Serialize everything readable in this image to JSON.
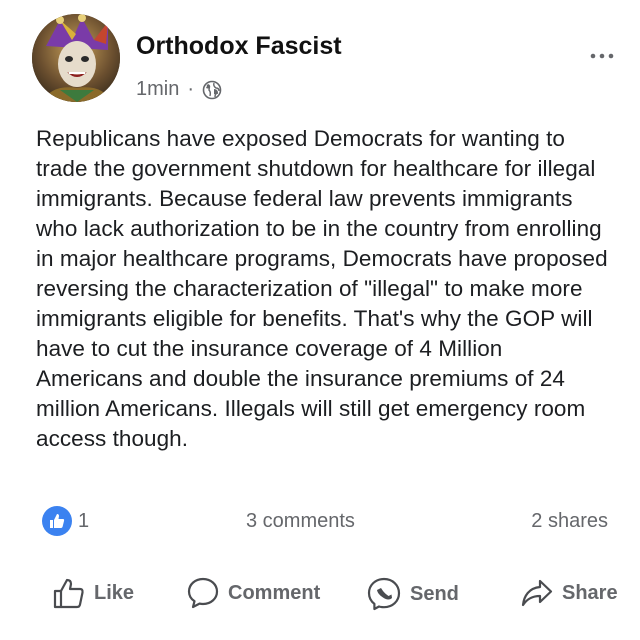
{
  "post": {
    "author_name": "Orthodox Fascist",
    "timestamp": "1min",
    "separator": "·",
    "audience_icon": "globe-icon",
    "more_icon": "more-options-icon",
    "body": "Republicans have exposed Democrats for wanting to trade the government shutdown for healthcare for illegal immigrants. Because federal law prevents immigrants who lack authorization to be in the country from enrolling in major healthcare programs, Democrats have proposed reversing the characterization of \"illegal\" to make more immigrants eligible for benefits. That's why the GOP will have to cut the insurance coverage of 4 Million Americans and double the insurance premiums of 24 million Americans. Illegals will still get emergency room access though."
  },
  "stats": {
    "likes": "1",
    "comments": "3 comments",
    "shares": "2 shares"
  },
  "actions": {
    "like": "Like",
    "comment": "Comment",
    "send": "Send",
    "share": "Share"
  },
  "colors": {
    "text": "#1c1e21",
    "secondary_text": "#65676b",
    "like_badge": "#3b82f0",
    "background": "#ffffff"
  }
}
